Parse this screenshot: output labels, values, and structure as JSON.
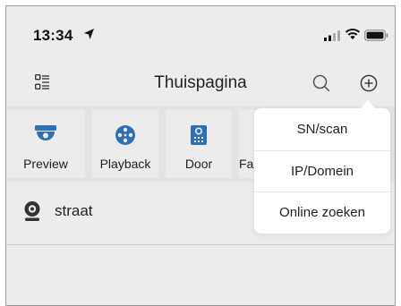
{
  "status_bar": {
    "time": "13:34"
  },
  "nav": {
    "title": "Thuispagina"
  },
  "device_types": [
    {
      "label": "Preview",
      "icon": "dome-camera-icon"
    },
    {
      "label": "Playback",
      "icon": "film-reel-icon"
    },
    {
      "label": "Door",
      "icon": "door-station-icon"
    },
    {
      "label": "Fa",
      "icon": "favorite-icon"
    }
  ],
  "devices": [
    {
      "name": "straat",
      "icon": "camera-icon"
    }
  ],
  "add_menu": {
    "items": [
      "SN/scan",
      "IP/Domein",
      "Online zoeken"
    ]
  },
  "colors": {
    "accent": "#2f6fb3",
    "background": "#ececec",
    "popup": "#ffffff"
  }
}
